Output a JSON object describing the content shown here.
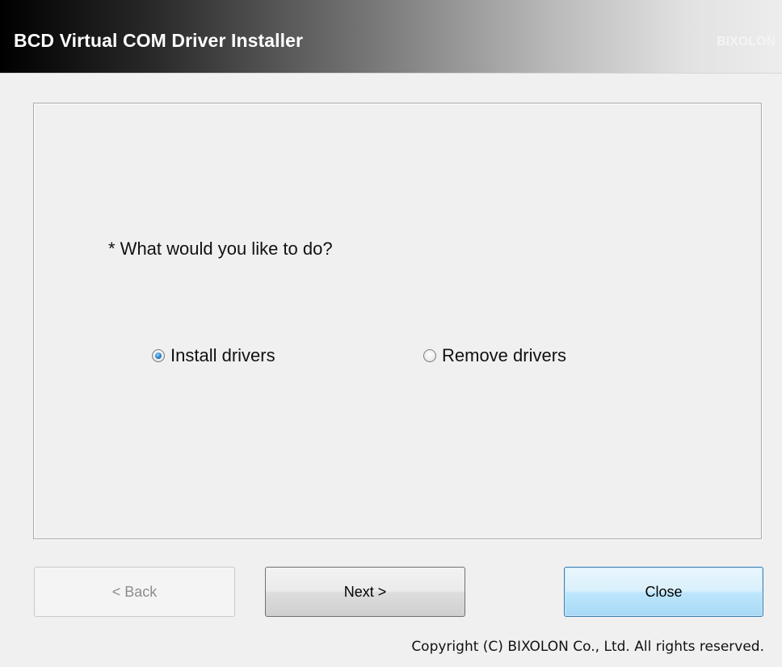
{
  "header": {
    "title": "BCD Virtual COM Driver Installer",
    "brand": "BIXOLON"
  },
  "main": {
    "question": "* What would you like to do?",
    "options": [
      {
        "label": "Install drivers",
        "checked": true
      },
      {
        "label": "Remove drivers",
        "checked": false
      }
    ]
  },
  "buttons": {
    "back_label": "< Back",
    "back_enabled": false,
    "next_label": "Next >",
    "close_label": "Close"
  },
  "footer": {
    "copyright": "Copyright (C) BIXOLON Co., Ltd. All rights reserved."
  },
  "colors": {
    "header_gradient_start": "#000000",
    "header_gradient_end": "#ededed",
    "focus_button": "#3c7fb1",
    "window_bg": "#f0f0f0"
  }
}
